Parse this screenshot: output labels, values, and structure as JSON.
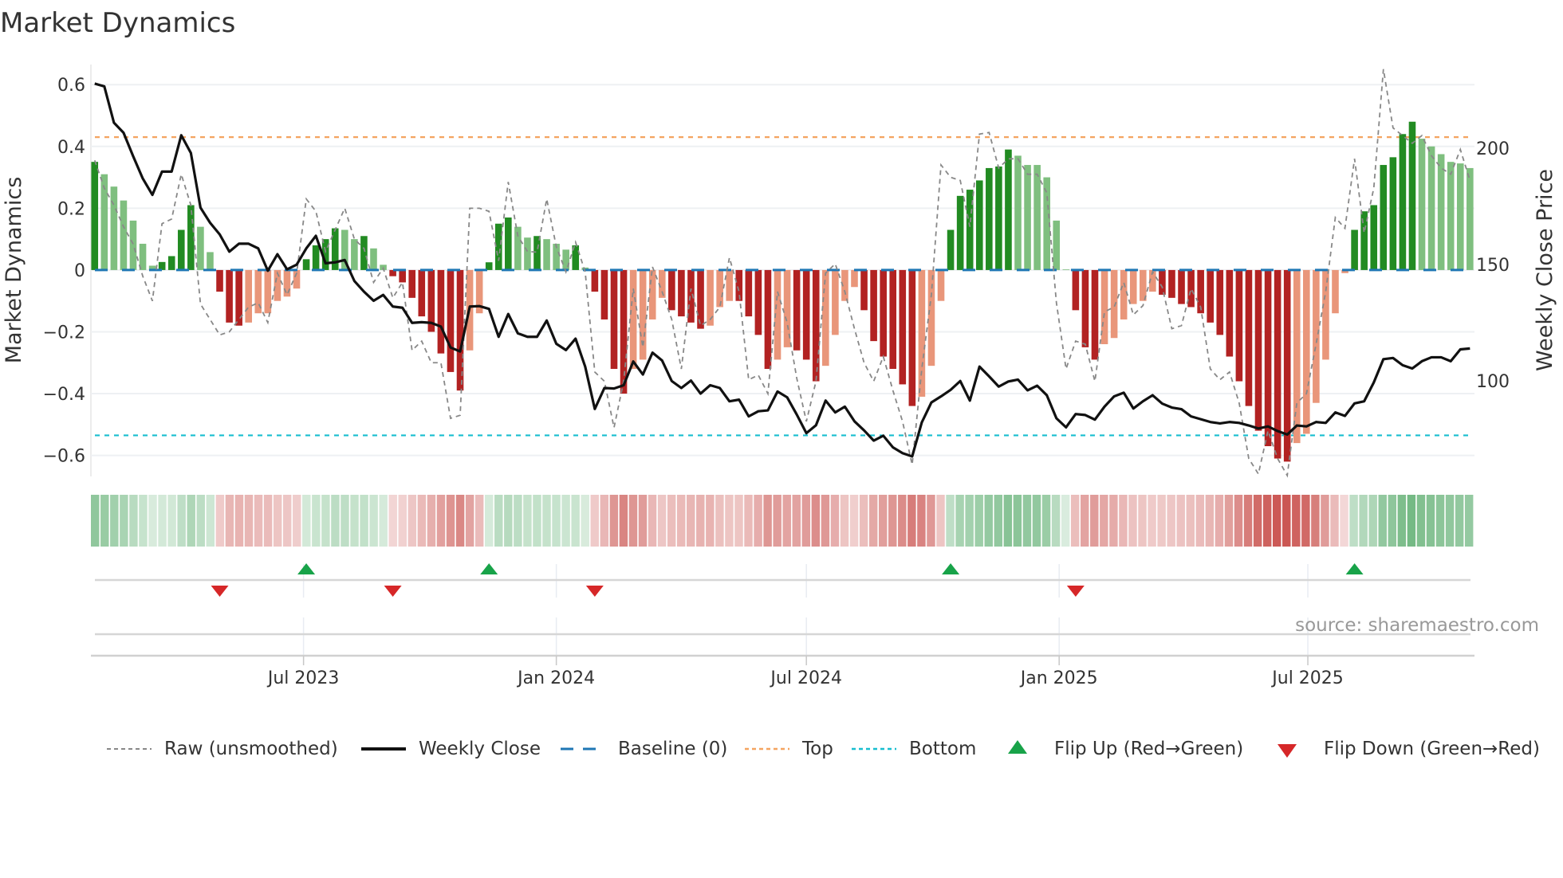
{
  "title": "Market Dynamics",
  "source": "source: sharemaestro.com",
  "legend": {
    "raw": "Raw (unsmoothed)",
    "close": "Weekly Close",
    "baseline": "Baseline (0)",
    "top": "Top",
    "bottom": "Bottom",
    "flip_up": "Flip Up (Red→Green)",
    "flip_down": "Flip Down (Green→Red)"
  },
  "colors": {
    "pos_strong": "#228b22",
    "pos_weak": "#7fbf7f",
    "neg_strong": "#b22222",
    "neg_weak": "#e9967a",
    "raw": "#888888",
    "close": "#111111",
    "baseline": "#1f77b4",
    "top": "#f4a460",
    "bottom": "#17becf",
    "flip_up": "#18a349",
    "flip_down": "#d62728"
  },
  "chart_data": {
    "type": "bar",
    "title": "Market Dynamics",
    "ylabel": "Market Dynamics",
    "y2label": "Weekly Close Price",
    "x_start": "2023-01-30",
    "x_step_days": 7,
    "ylim": [
      -0.668,
      0.665
    ],
    "y2lim": [
      59,
      236
    ],
    "yticks": [
      {
        "v": 0.6,
        "label": "0.6"
      },
      {
        "v": 0.4,
        "label": "0.4"
      },
      {
        "v": 0.2,
        "label": "0.2"
      },
      {
        "v": 0,
        "label": "0"
      },
      {
        "v": -0.2,
        "label": "−0.2"
      },
      {
        "v": -0.4,
        "label": "−0.4"
      },
      {
        "v": -0.6,
        "label": "−0.6"
      }
    ],
    "y2ticks": [
      {
        "v": 200,
        "label": "200"
      },
      {
        "v": 150,
        "label": "150"
      },
      {
        "v": 100,
        "label": "100"
      }
    ],
    "xticks": [
      {
        "date": "2023-07-01",
        "label": "Jul 2023"
      },
      {
        "date": "2024-01-01",
        "label": "Jan 2024"
      },
      {
        "date": "2024-07-01",
        "label": "Jul 2024"
      },
      {
        "date": "2025-01-01",
        "label": "Jan 2025"
      },
      {
        "date": "2025-07-01",
        "label": "Jul 2025"
      }
    ],
    "top_threshold": 0.43,
    "bottom_threshold": -0.535,
    "baseline": 0,
    "grid": true,
    "legend_position": "bottom",
    "dynamics": [
      0.35,
      0.31,
      0.27,
      0.225,
      0.16,
      0.085,
      0.014,
      0.026,
      0.045,
      0.13,
      0.21,
      0.14,
      0.058,
      -0.07,
      -0.17,
      -0.18,
      -0.17,
      -0.14,
      -0.14,
      -0.1,
      -0.086,
      -0.06,
      0.035,
      0.08,
      0.1,
      0.135,
      0.13,
      0.1,
      0.11,
      0.07,
      0.017,
      -0.02,
      -0.04,
      -0.09,
      -0.15,
      -0.2,
      -0.27,
      -0.33,
      -0.39,
      -0.26,
      -0.14,
      0.025,
      0.15,
      0.17,
      0.14,
      0.105,
      0.11,
      0.1,
      0.085,
      0.066,
      0.08,
      0.008,
      -0.07,
      -0.16,
      -0.32,
      -0.4,
      -0.32,
      -0.29,
      -0.16,
      -0.09,
      -0.13,
      -0.15,
      -0.17,
      -0.19,
      -0.18,
      -0.12,
      -0.1,
      -0.1,
      -0.15,
      -0.21,
      -0.32,
      -0.29,
      -0.25,
      -0.26,
      -0.29,
      -0.36,
      -0.31,
      -0.21,
      -0.1,
      -0.055,
      -0.13,
      -0.23,
      -0.28,
      -0.32,
      -0.37,
      -0.44,
      -0.41,
      -0.31,
      -0.1,
      0.13,
      0.24,
      0.26,
      0.29,
      0.33,
      0.335,
      0.39,
      0.37,
      0.34,
      0.34,
      0.3,
      0.16,
      0.002,
      -0.13,
      -0.25,
      -0.29,
      -0.24,
      -0.22,
      -0.16,
      -0.11,
      -0.1,
      -0.07,
      -0.08,
      -0.09,
      -0.11,
      -0.12,
      -0.14,
      -0.17,
      -0.21,
      -0.28,
      -0.36,
      -0.44,
      -0.52,
      -0.57,
      -0.61,
      -0.62,
      -0.56,
      -0.53,
      -0.43,
      -0.29,
      -0.14,
      -0.01,
      0.13,
      0.19,
      0.21,
      0.34,
      0.365,
      0.44,
      0.48,
      0.425,
      0.4,
      0.375,
      0.35,
      0.345,
      0.33
    ],
    "strengthening": [
      1,
      0,
      0,
      0,
      0,
      0,
      0,
      1,
      1,
      1,
      1,
      0,
      0,
      1,
      1,
      1,
      0,
      0,
      0,
      0,
      0,
      0,
      1,
      1,
      1,
      1,
      0,
      0,
      1,
      0,
      0,
      1,
      1,
      1,
      1,
      1,
      1,
      1,
      1,
      0,
      0,
      1,
      1,
      1,
      0,
      0,
      1,
      0,
      0,
      0,
      1,
      0,
      1,
      1,
      1,
      1,
      0,
      0,
      0,
      0,
      1,
      1,
      1,
      1,
      0,
      0,
      0,
      1,
      1,
      1,
      1,
      0,
      0,
      1,
      1,
      1,
      0,
      0,
      0,
      0,
      1,
      1,
      1,
      1,
      1,
      1,
      0,
      0,
      0,
      1,
      1,
      1,
      1,
      1,
      1,
      1,
      0,
      0,
      0,
      0,
      0,
      0,
      1,
      1,
      1,
      0,
      0,
      0,
      0,
      0,
      0,
      1,
      1,
      1,
      1,
      1,
      1,
      1,
      1,
      1,
      1,
      1,
      1,
      1,
      1,
      0,
      0,
      0,
      0,
      0,
      0,
      1,
      1,
      1,
      1,
      1,
      1,
      1,
      0,
      0,
      0,
      0,
      0,
      0
    ],
    "raw": [
      0.355,
      0.265,
      0.21,
      0.14,
      0.084,
      -0.02,
      -0.1,
      0.15,
      0.165,
      0.31,
      0.21,
      -0.11,
      -0.16,
      -0.21,
      -0.2,
      -0.16,
      -0.12,
      -0.106,
      -0.17,
      -0.01,
      -0.08,
      -0.01,
      0.23,
      0.19,
      0.06,
      0.13,
      0.2,
      0.1,
      0.07,
      -0.04,
      0.006,
      -0.09,
      -0.04,
      -0.26,
      -0.23,
      -0.3,
      -0.3,
      -0.48,
      -0.47,
      0.2,
      0.2,
      0.19,
      0.03,
      0.285,
      0.11,
      0.06,
      0.058,
      0.23,
      0.075,
      -0.006,
      0.09,
      -0.006,
      -0.33,
      -0.36,
      -0.51,
      -0.36,
      -0.06,
      -0.25,
      0.01,
      -0.07,
      -0.16,
      -0.32,
      -0.06,
      -0.18,
      -0.16,
      -0.12,
      0.04,
      -0.07,
      -0.355,
      -0.34,
      -0.4,
      -0.07,
      -0.17,
      -0.35,
      -0.49,
      -0.36,
      -0.01,
      0.02,
      -0.07,
      -0.19,
      -0.3,
      -0.36,
      -0.28,
      -0.39,
      -0.49,
      -0.63,
      -0.32,
      -0.08,
      0.34,
      0.3,
      0.29,
      0.14,
      0.44,
      0.445,
      0.33,
      0.36,
      0.36,
      0.31,
      0.31,
      0.25,
      -0.106,
      -0.32,
      -0.23,
      -0.24,
      -0.36,
      -0.135,
      -0.12,
      -0.04,
      -0.145,
      -0.115,
      -0.006,
      -0.055,
      -0.19,
      -0.18,
      -0.06,
      -0.12,
      -0.32,
      -0.355,
      -0.33,
      -0.43,
      -0.61,
      -0.66,
      -0.52,
      -0.61,
      -0.665,
      -0.43,
      -0.4,
      -0.24,
      -0.07,
      0.17,
      0.135,
      0.36,
      0.12,
      0.265,
      0.65,
      0.46,
      0.435,
      0.41,
      0.435,
      0.37,
      0.33,
      0.31,
      0.39,
      0.29
    ],
    "close": [
      227.8,
      226.6,
      211,
      206.7,
      196.6,
      187,
      180,
      190,
      190,
      205.6,
      198,
      174.5,
      168,
      163,
      155.6,
      159,
      159,
      157,
      147.4,
      154.5,
      148,
      150,
      157,
      162.4,
      150.6,
      151,
      152,
      143,
      138.4,
      134.5,
      137,
      132,
      131.5,
      125,
      125.3,
      125,
      123.4,
      114.4,
      112.7,
      132,
      132.2,
      131,
      119,
      128.8,
      120.5,
      119,
      119,
      126,
      116,
      113.3,
      118.2,
      106.2,
      88,
      97,
      96.8,
      98.2,
      108.4,
      102.8,
      112.2,
      108.8,
      100,
      97,
      100.2,
      94.6,
      98.2,
      97,
      91.3,
      92,
      84.8,
      87,
      87.4,
      95.5,
      93,
      85.6,
      77.6,
      81,
      91.6,
      86.5,
      89,
      82.7,
      78.8,
      74.4,
      76.5,
      71.5,
      69,
      67.6,
      82.2,
      90.8,
      93.4,
      96.2,
      100,
      91.6,
      106.2,
      102,
      97.6,
      99.8,
      100.6,
      96,
      98,
      93.9,
      84,
      80.1,
      85.8,
      85.4,
      83.4,
      89,
      93.4,
      95,
      88.2,
      91.3,
      93.9,
      90.3,
      88.6,
      87.9,
      84.8,
      83.6,
      82.4,
      81.8,
      82.4,
      82,
      80.9,
      79.6,
      80.5,
      78.5,
      77,
      80.9,
      80.5,
      82.4,
      82,
      86.5,
      85,
      90.4,
      91.3,
      99.4,
      109.4,
      109.9,
      106.8,
      105.4,
      108.5,
      110.2,
      110.2,
      108.5,
      113.6,
      114
    ]
  }
}
